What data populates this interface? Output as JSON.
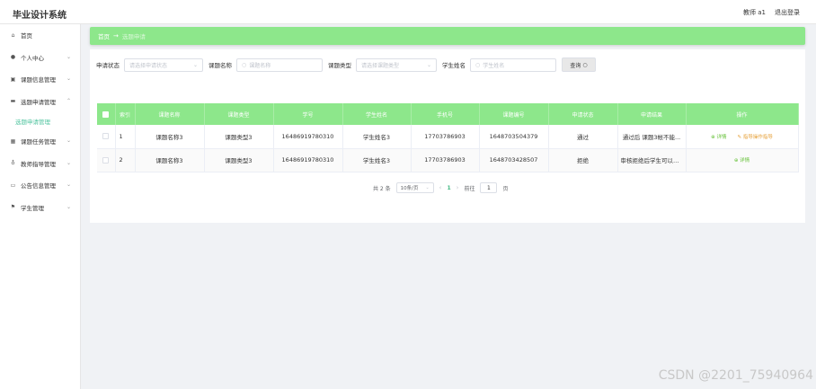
{
  "header": {
    "app_title": "毕业设计系统",
    "user_label": "教师 a1",
    "logout_label": "退出登录"
  },
  "sidebar": {
    "items": [
      {
        "label": "首页",
        "icon": "home-icon",
        "expandable": false
      },
      {
        "label": "个人中心",
        "icon": "user-icon",
        "expandable": true
      },
      {
        "label": "课题信息管理",
        "icon": "book-icon",
        "expandable": true
      },
      {
        "label": "选题申请管理",
        "icon": "monitor-icon",
        "expandable": true,
        "expanded": true
      },
      {
        "label": "课题任务管理",
        "icon": "grid-icon",
        "expandable": true
      },
      {
        "label": "教师指导管理",
        "icon": "mic-icon",
        "expandable": true
      },
      {
        "label": "公告信息管理",
        "icon": "card-icon",
        "expandable": true
      },
      {
        "label": "学生管理",
        "icon": "flag-icon",
        "expandable": true
      }
    ],
    "submenu": [
      {
        "label": "选题申请管理",
        "active": true
      }
    ]
  },
  "breadcrumb": {
    "home": "首页",
    "separator": "→",
    "current": "选题申请"
  },
  "filters": {
    "status_label": "申请状态",
    "status_placeholder": "请选择申请状态",
    "topic_name_label": "课题名称",
    "topic_name_placeholder": "课题名称",
    "topic_type_label": "课题类型",
    "topic_type_placeholder": "请选择课题类型",
    "student_name_label": "学生姓名",
    "student_name_placeholder": "学生姓名",
    "search_button": "查询"
  },
  "table": {
    "columns": [
      "索引",
      "课题名称",
      "课题类型",
      "学号",
      "学生姓名",
      "手机号",
      "课题编号",
      "申请状态",
      "申请结果",
      "操作"
    ],
    "rows": [
      {
        "index": "1",
        "topic_name": "课题名称3",
        "topic_type": "课题类型3",
        "student_no": "16486919780310",
        "student_name": "学生姓名3",
        "phone": "17703786903",
        "topic_no": "1648703504379",
        "status": "通过",
        "result": "通过后 课题3帐不能...",
        "actions": [
          "详情",
          "指导操作指导"
        ]
      },
      {
        "index": "2",
        "topic_name": "课题名称3",
        "topic_type": "课题类型3",
        "student_no": "16486919780310",
        "student_name": "学生姓名3",
        "phone": "17703786903",
        "topic_no": "1648703428507",
        "status": "拒绝",
        "result": "审核拒绝后学生可以在...",
        "actions": [
          "详情"
        ]
      }
    ]
  },
  "pagination": {
    "total_text": "共 2 条",
    "page_size": "10条/页",
    "prev": "‹",
    "current_page": "1",
    "next": "›",
    "goto_label": "前往",
    "goto_value": "1",
    "page_suffix": "页"
  },
  "watermark": "CSDN @2201_75940964",
  "colors": {
    "accent_green": "#8de78b",
    "active_text": "#52c4a0",
    "action_green": "#67c23a",
    "action_orange": "#e6a23c"
  }
}
